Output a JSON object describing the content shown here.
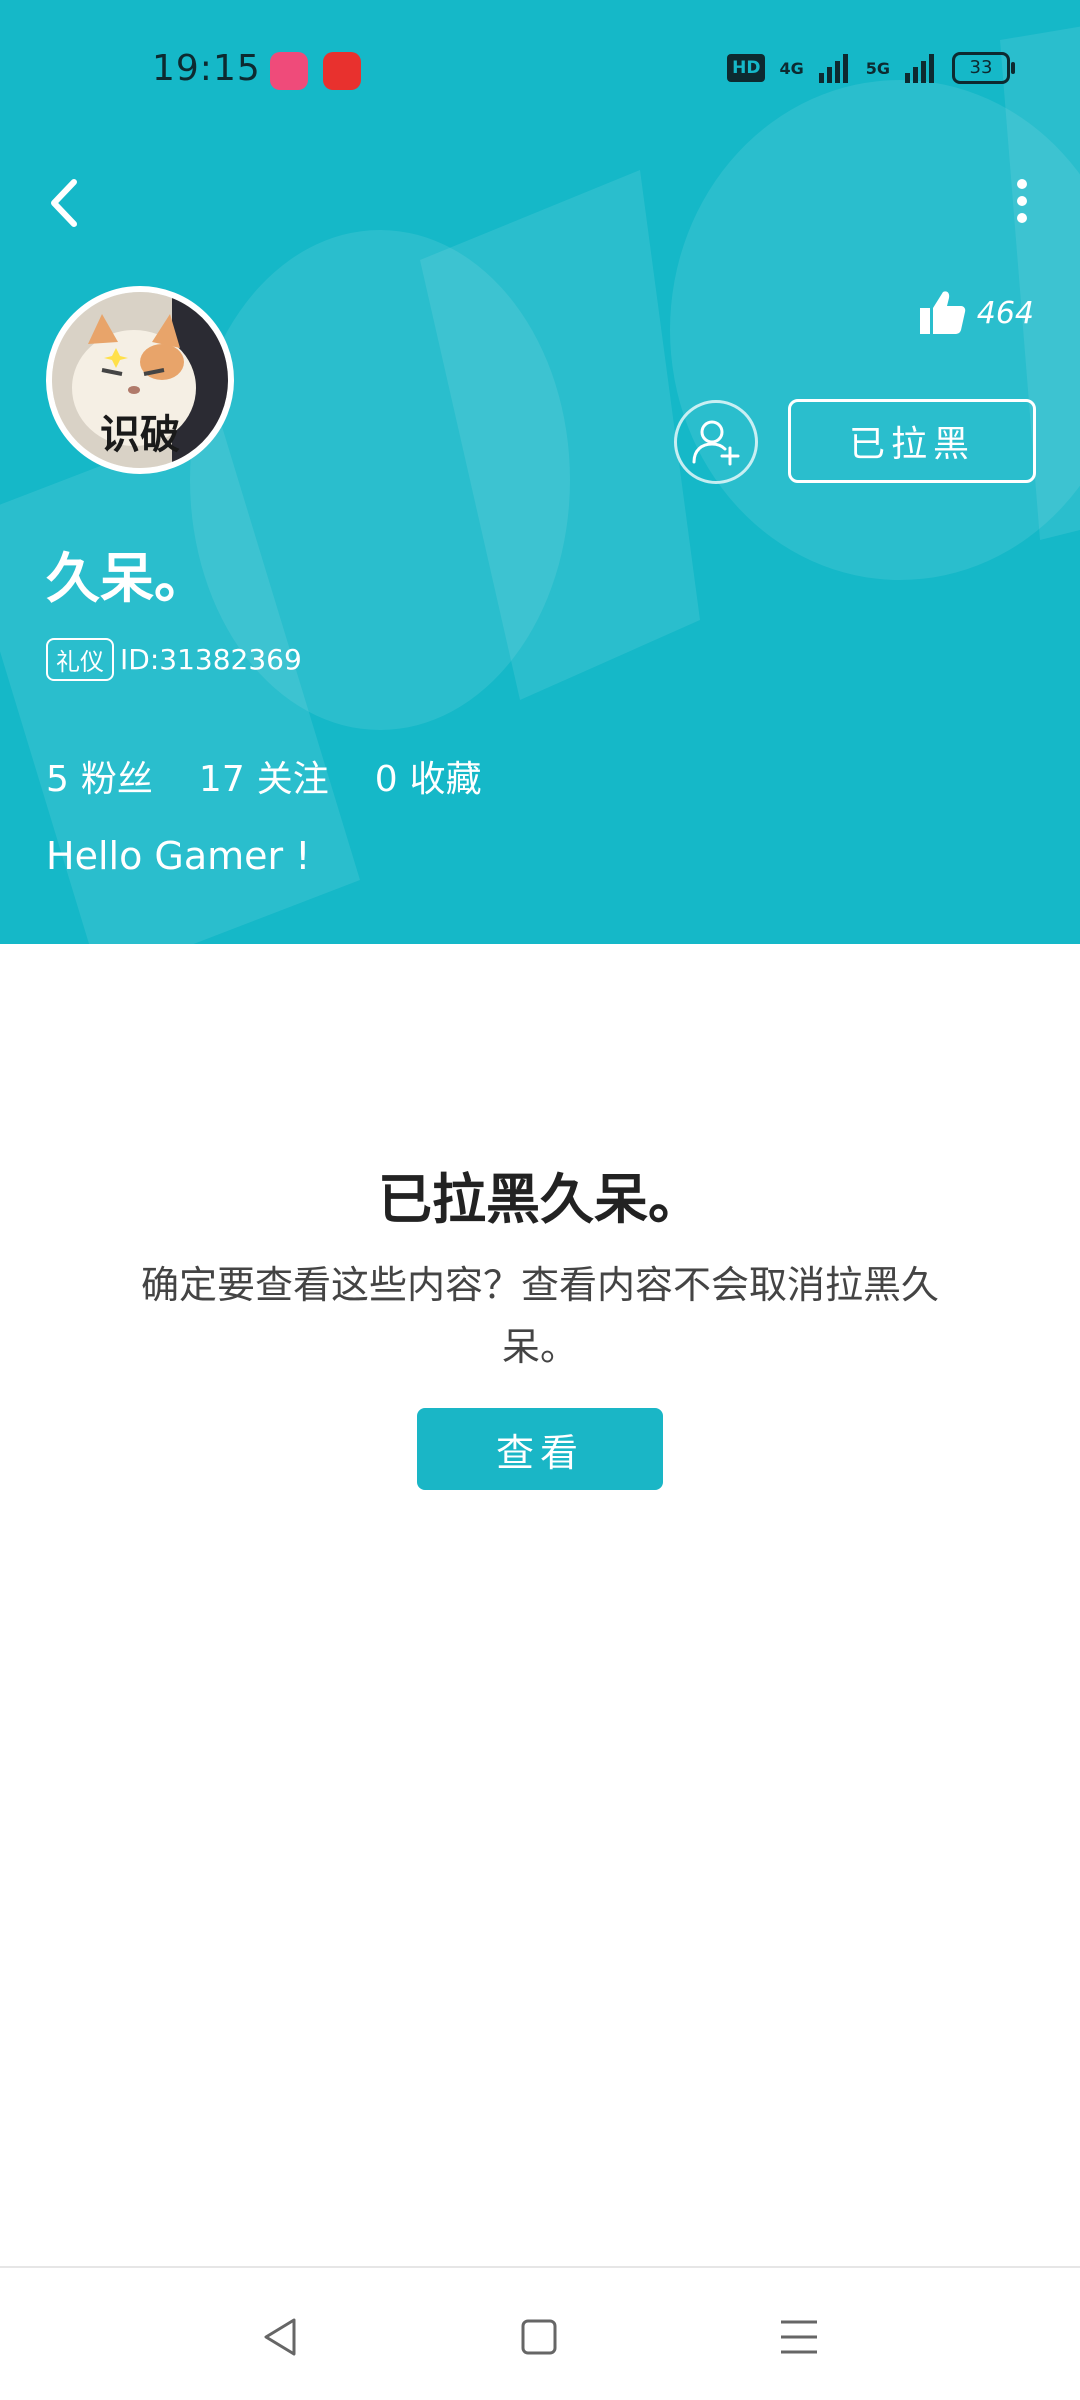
{
  "status_bar": {
    "time": "19:15",
    "hd": "HD",
    "signal_1": "4G",
    "signal_2": "5G",
    "battery": "33"
  },
  "header": {
    "likes_count": "464",
    "avatar_caption": "识破",
    "blocked_label": "已拉黑",
    "username": "久呆。",
    "tag": "礼仪",
    "id_text": "ID:31382369",
    "stats": [
      {
        "value": "5",
        "label": "粉丝"
      },
      {
        "value": "17",
        "label": "关注"
      },
      {
        "value": "0",
        "label": "收藏"
      }
    ],
    "bio": "Hello Gamer !"
  },
  "blocked_notice": {
    "title": "已拉黑久呆。",
    "description": "确定要查看这些内容？查看内容不会取消拉黑久呆。",
    "view_button": "查看"
  },
  "colors": {
    "header_bg": "#15b8c8",
    "accent": "#1ab6c6"
  },
  "icons": {
    "back": "back-arrow-icon",
    "more": "more-vertical-icon",
    "like": "thumbs-up-icon",
    "follow": "add-user-icon"
  }
}
